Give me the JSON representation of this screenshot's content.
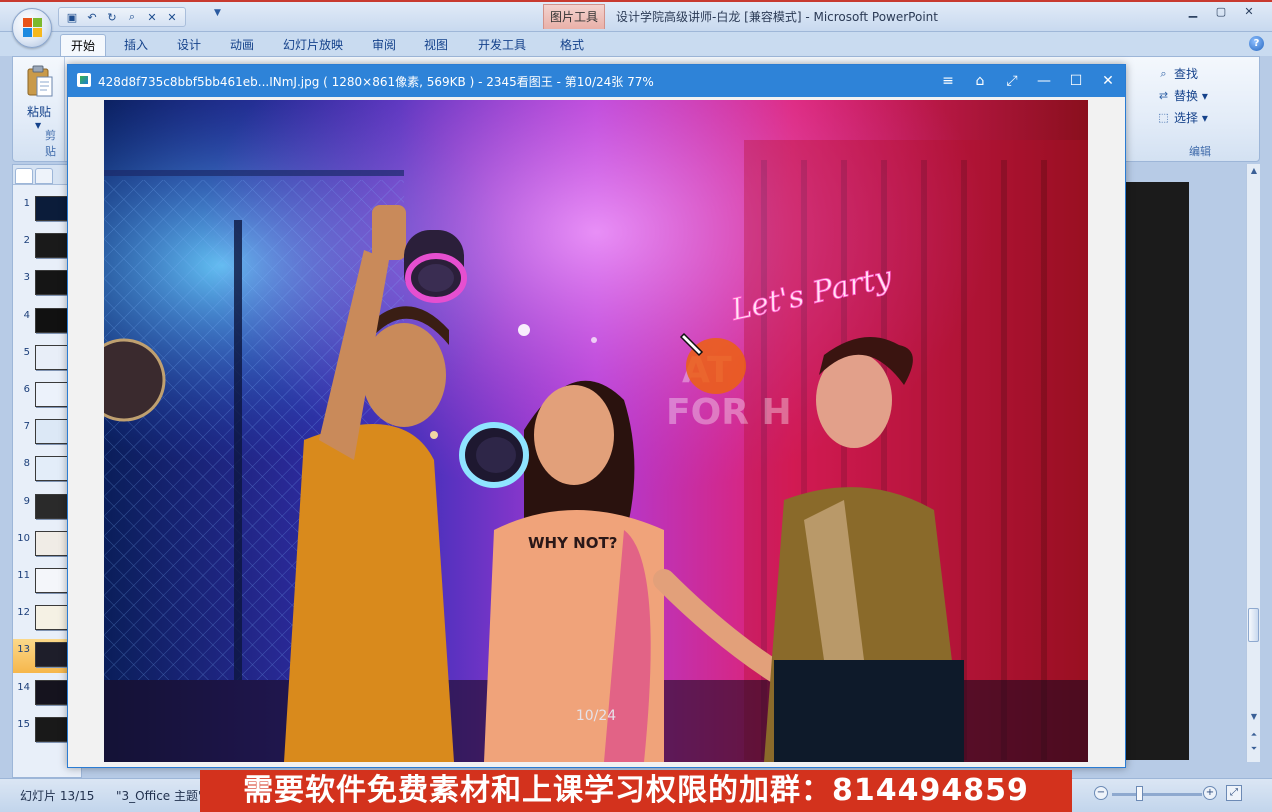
{
  "powerpoint": {
    "context_tab": "图片工具",
    "window_title": "设计学院高级讲师-白龙 [兼容模式] - Microsoft PowerPoint",
    "quick_access": [
      "save",
      "undo",
      "redo",
      "refresh",
      "preview",
      "close-doc",
      "close"
    ],
    "window_controls": {
      "minimize": "▁",
      "restore": "▢",
      "close": "✕"
    },
    "tabs": [
      "开始",
      "插入",
      "设计",
      "动画",
      "幻灯片放映",
      "审阅",
      "视图",
      "开发工具",
      "格式"
    ],
    "active_tab": "开始",
    "ribbon": {
      "paste_label": "粘贴",
      "clipboard_caption": "剪贴",
      "find_label": "查找",
      "replace_label": "替换 ▾",
      "select_label": "选择 ▾",
      "edit_caption": "编辑"
    },
    "slides": [
      {
        "num": "1",
        "bg": "#0b1c3a"
      },
      {
        "num": "2",
        "bg": "#1a1a1a"
      },
      {
        "num": "3",
        "bg": "#151515"
      },
      {
        "num": "4",
        "bg": "#111111"
      },
      {
        "num": "5",
        "bg": "#e8eef8"
      },
      {
        "num": "6",
        "bg": "#ecf2fb"
      },
      {
        "num": "7",
        "bg": "#dce8f6"
      },
      {
        "num": "8",
        "bg": "#e3edf9"
      },
      {
        "num": "9",
        "bg": "#2a2a2a"
      },
      {
        "num": "10",
        "bg": "#f0ece6"
      },
      {
        "num": "11",
        "bg": "#f4f6fa"
      },
      {
        "num": "12",
        "bg": "#f5f1e4"
      },
      {
        "num": "13",
        "bg": "#1e1e2a"
      },
      {
        "num": "14",
        "bg": "#15131e"
      },
      {
        "num": "15",
        "bg": "#191919"
      }
    ],
    "active_slide": "13",
    "status": {
      "slide_info": "幻灯片 13/15",
      "theme": "\"3_Office 主题\""
    }
  },
  "viewer": {
    "title": "428d8f735c8bbf5bb461eb...INmJ.jpg ( 1280×861像素, 569KB ) - 2345看图王 - 第10/24张 77%",
    "controls": [
      "menu",
      "skin",
      "fullscreen",
      "minimize",
      "maximize",
      "close"
    ],
    "counter": "10/24",
    "photo_texts": {
      "neon_sign": "Let's Party",
      "shirt_text": "WHY NOT?",
      "wall_text_1": "AT",
      "wall_text_2": "FOR H"
    }
  },
  "banner": {
    "text": "需要软件免费素材和上课学习权限的加群：814494859"
  },
  "colors": {
    "viewer_titlebar": "#2e83d8",
    "banner_bg": "#d3321d",
    "ribbon_bg": "#dfe9f6",
    "active_slide": "#f6b74c"
  }
}
